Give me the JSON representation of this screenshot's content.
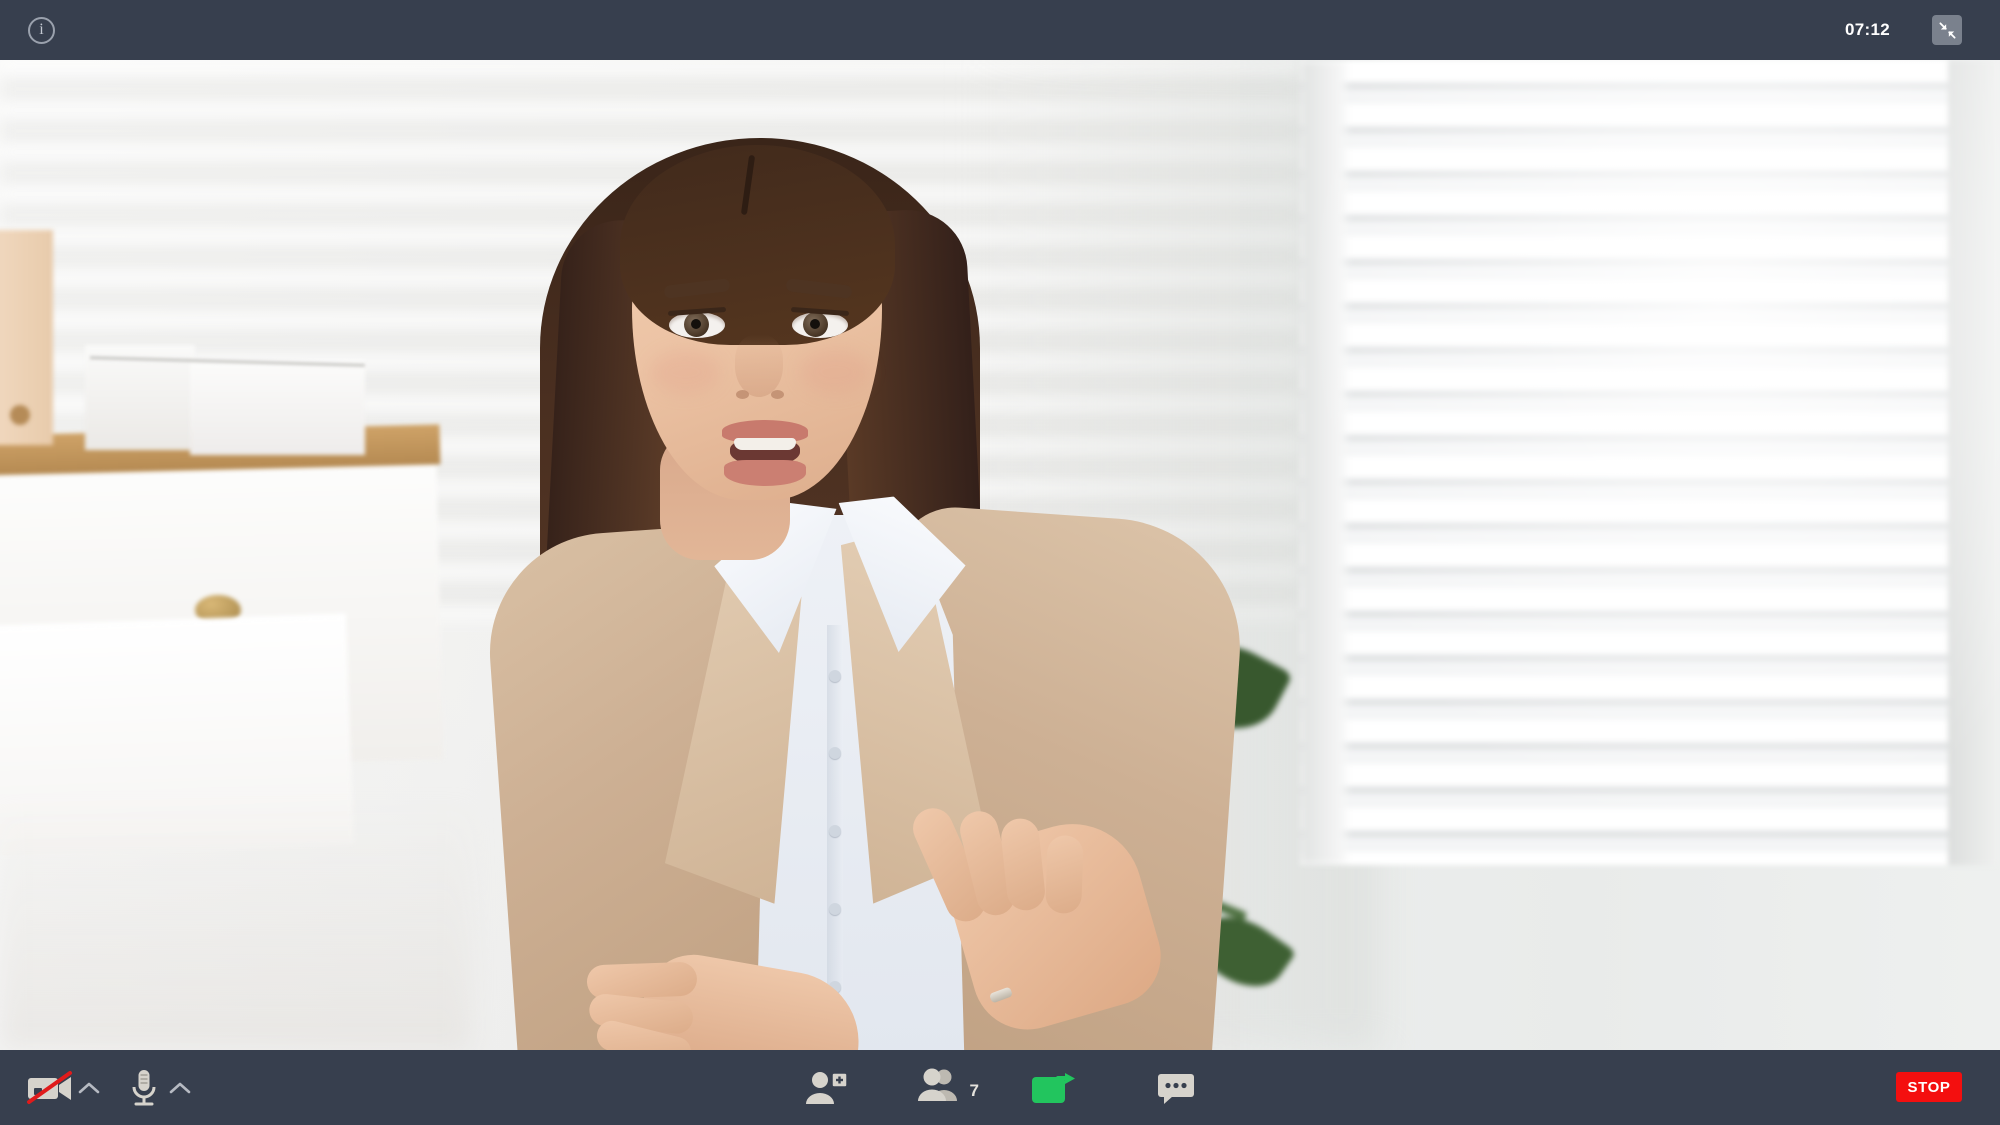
{
  "app": {
    "name": "video-call-window",
    "theme": {
      "bar_background": "#373f4e",
      "icon_color": "#d6d3cc",
      "share_active": "#22c55e",
      "stop_red": "#f40f0f",
      "camera_off_slash": "#e01b1b",
      "collapse_button_bg": "#7a818d"
    }
  },
  "topbar": {
    "info_button": {
      "label": "i",
      "icon": "info-icon",
      "tooltip": "Meeting information"
    },
    "timer": "07:12",
    "collapse_button": {
      "icon": "collapse-arrows-icon",
      "tooltip": "Exit full screen"
    }
  },
  "stage": {
    "participant": {
      "description": "Woman in beige blazer and white shirt speaking on camera",
      "video_active": true
    },
    "background": {
      "description": "Bright home office with white wall, wooden shelf, white storage boxes, green plant and white window blinds"
    }
  },
  "bottombar": {
    "controls": [
      {
        "name": "camera-toggle",
        "icon": "camera-off-icon",
        "state": "off",
        "label": "Camera"
      },
      {
        "name": "camera-options",
        "icon": "chevron-up-icon",
        "label": "Camera options"
      },
      {
        "name": "microphone-toggle",
        "icon": "microphone-icon",
        "state": "on",
        "label": "Microphone"
      },
      {
        "name": "microphone-options",
        "icon": "chevron-up-icon",
        "label": "Microphone options"
      },
      {
        "name": "add-participant",
        "icon": "person-add-icon",
        "label": "Invite participant"
      },
      {
        "name": "participants",
        "icon": "people-icon",
        "label": "Participants",
        "count": "7"
      },
      {
        "name": "share-screen",
        "icon": "screen-share-icon",
        "state": "active",
        "label": "Share screen"
      },
      {
        "name": "chat",
        "icon": "chat-bubble-icon",
        "label": "Chat"
      }
    ],
    "participants_count": "7",
    "stop_button": {
      "label": "STOP",
      "name": "stop-call-button"
    }
  }
}
